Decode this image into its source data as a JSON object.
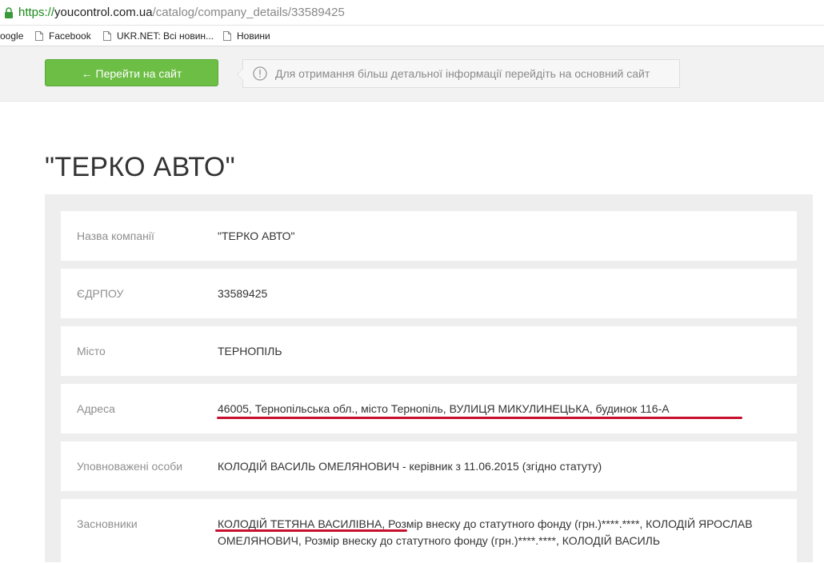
{
  "browser": {
    "url_proto": "https://",
    "url_host": "youcontrol.com.ua",
    "url_path": "/catalog/company_details/33589425",
    "bookmarks": [
      {
        "label": "oogle"
      },
      {
        "label": "Facebook"
      },
      {
        "label": "UKR.NET: Всі новин..."
      },
      {
        "label": "Новини"
      }
    ]
  },
  "header": {
    "go_site_label": "← Перейти на сайт",
    "info_text": "Для отримання більш детальної інформації перейдіть на основний сайт"
  },
  "company": {
    "title": "\"ТЕРКО АВТО\"",
    "rows": [
      {
        "label": "Назва компанії",
        "value": "\"ТЕРКО АВТО\""
      },
      {
        "label": "ЄДРПОУ",
        "value": "33589425"
      },
      {
        "label": "Місто",
        "value": "ТЕРНОПІЛЬ"
      },
      {
        "label": "Адреса",
        "value": "46005, Тернопільська обл., місто Тернопіль, ВУЛИЦЯ МИКУЛИНЕЦЬКА, будинок 116-А"
      },
      {
        "label": "Уповноважені особи",
        "value": "КОЛОДІЙ ВАСИЛЬ ОМЕЛЯНОВИЧ - керівник з 11.06.2015 (згідно статуту)"
      },
      {
        "label": "Засновники",
        "value": "КОЛОДІЙ ТЕТЯНА ВАСИЛІВНА, Розмір внеску до статутного фонду (грн.)****.****, КОЛОДІЙ ЯРОСЛАВ ОМЕЛЯНОВИЧ, Розмір внеску до статутного фонду (грн.)****.****, КОЛОДІЙ ВАСИЛЬ"
      }
    ]
  },
  "colors": {
    "accent_green": "#6cbe45",
    "highlight_red": "#c8102e"
  }
}
